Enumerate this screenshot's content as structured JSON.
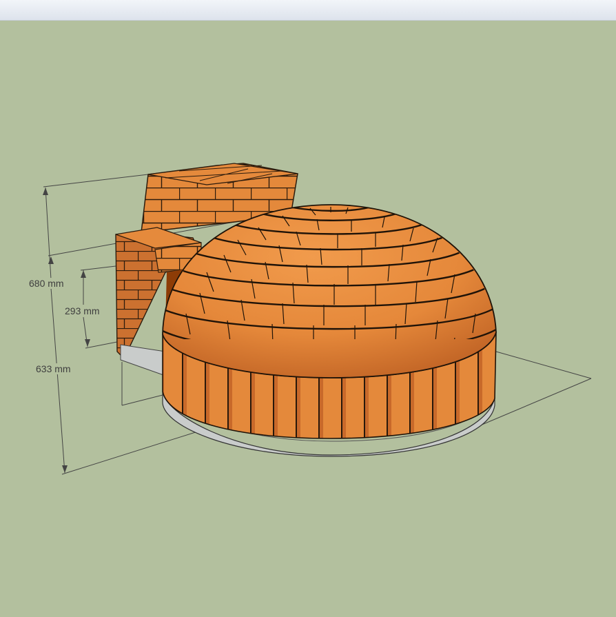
{
  "viewport": {
    "background": "#b3c09e",
    "brick_color": "#e5883a",
    "mortar_color": "#2a1a0c",
    "base_color": "#c9cccb"
  },
  "dimensions": {
    "height_total": "680 mm",
    "height_opening": "293 mm",
    "depth": "633 mm"
  }
}
